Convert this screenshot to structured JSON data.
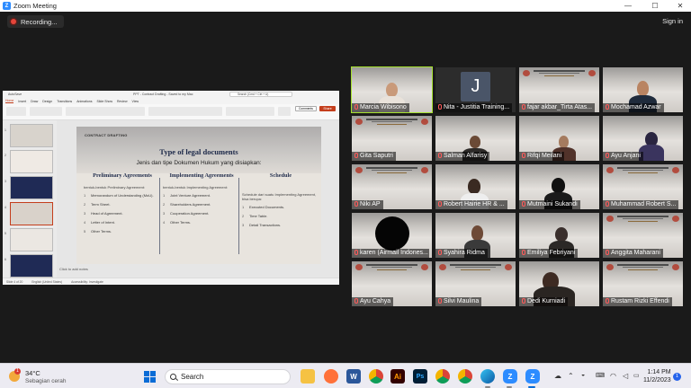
{
  "window": {
    "title": "Zoom Meeting",
    "controls": [
      "—",
      "☐",
      "✕"
    ]
  },
  "top": {
    "recording_label": "Recording...",
    "sign_in": "Sign in"
  },
  "ppt": {
    "autosave": "AutoSave",
    "doc_title": "PPT - Contract Drafting - Saved to my Mac",
    "search": "Search (Cmd + Ctrl + U)",
    "tabs": [
      "Home",
      "Insert",
      "Draw",
      "Design",
      "Transitions",
      "Animations",
      "Slide Show",
      "Review",
      "View"
    ],
    "comments": "Comments",
    "share": "Share",
    "notes_placeholder": "Click to add notes",
    "status": [
      "Slide 4 of 20",
      "English (United States)",
      "Accessibility: Investigate"
    ],
    "thumb_numbers": [
      "1",
      "2",
      "3",
      "4",
      "5",
      "6"
    ],
    "slide": {
      "tag": "CONTRACT DRAFTING",
      "title": "Type of legal documents",
      "subtitle": "Jenis dan tipe Dokumen Hukum yang disiapkan:",
      "columns": [
        {
          "heading": "Preliminary Agreements",
          "desc": "bentuk-bentuk Preliminary Agreement:",
          "items": [
            "Memorandum of Understanding (MoU).",
            "Term Sheet.",
            "Head of Agreement.",
            "Letter of Intent.",
            "Other Terms."
          ]
        },
        {
          "heading": "Implementing Agreements",
          "desc": "bentuk-bentuk Implementing Agreement:",
          "items": [
            "Joint Venture Agreement.",
            "Shareholders Agreement.",
            "Cooperation Agreement.",
            "Other Terms."
          ]
        },
        {
          "heading": "Schedule",
          "desc": "Schedule dari suatu Implementing Agreement, bisa berupa:",
          "items": [
            "Executed Documents.",
            "Time Table.",
            "Detail Transactions."
          ]
        }
      ]
    }
  },
  "participants": [
    {
      "name": "Marcia Wibisono",
      "active": true
    },
    {
      "name": "Nita - Justitia Training...",
      "avatar": "J"
    },
    {
      "name": "fajar akbar_Tirta Atas..."
    },
    {
      "name": "Mochamad Azwar"
    },
    {
      "name": "Gita Saputri"
    },
    {
      "name": "Salman Alfarisy"
    },
    {
      "name": "Rifqi Meilani"
    },
    {
      "name": "Ayu Anjani"
    },
    {
      "name": "Niki AP"
    },
    {
      "name": "Mutmaini Sukandi"
    },
    {
      "name": "Robert Hairie HR & ..."
    },
    {
      "name": "Muhammad Robert S..."
    },
    {
      "name": "karen (Airmail Indones..."
    },
    {
      "name": "Syahira Ridma"
    },
    {
      "name": "Emiliya Febriyani"
    },
    {
      "name": "Anggita Maharani"
    },
    {
      "name": "Ayu Cahya"
    },
    {
      "name": "Silvi Maulina"
    },
    {
      "name": "Dedi Kurniadi"
    },
    {
      "name": "Rustam Rizki Effendi"
    }
  ],
  "taskbar": {
    "weather_badge": "1",
    "temperature": "34°C",
    "condition": "Sebagian cerah",
    "search_label": "Search",
    "time": "1:14 PM",
    "date": "11/2/2023",
    "notification_count": "1",
    "apps": [
      "windows-start",
      "file-explorer",
      "firefox",
      "word",
      "chrome",
      "illustrator",
      "photoshop",
      "chrome-profile-1",
      "chrome-profile-2",
      "edge",
      "zoom-1",
      "zoom-2"
    ]
  }
}
